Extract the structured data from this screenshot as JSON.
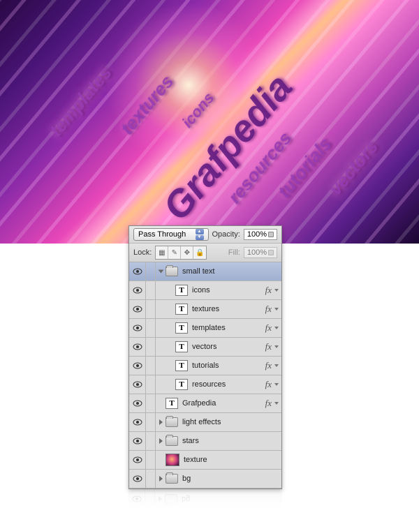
{
  "artwork": {
    "main": "Grafpedia",
    "words": {
      "templates": "templates",
      "textures": "textures",
      "icons": "icons",
      "resources": "resources",
      "tutorials": "tutorials",
      "vectors": "vectors"
    }
  },
  "panel": {
    "blend_mode": "Pass Through",
    "opacity_label": "Opacity:",
    "opacity_value": "100%",
    "lock_label": "Lock:",
    "fill_label": "Fill:",
    "fill_value": "100%",
    "fx_label": "fx"
  },
  "layers": {
    "group": "small text",
    "sub": [
      "icons",
      "textures",
      "templates",
      "vectors",
      "tutorials",
      "resources"
    ],
    "grafpedia": "Grafpedia",
    "light": "light effects",
    "stars": "stars",
    "texture": "texture",
    "bg": "bg"
  }
}
